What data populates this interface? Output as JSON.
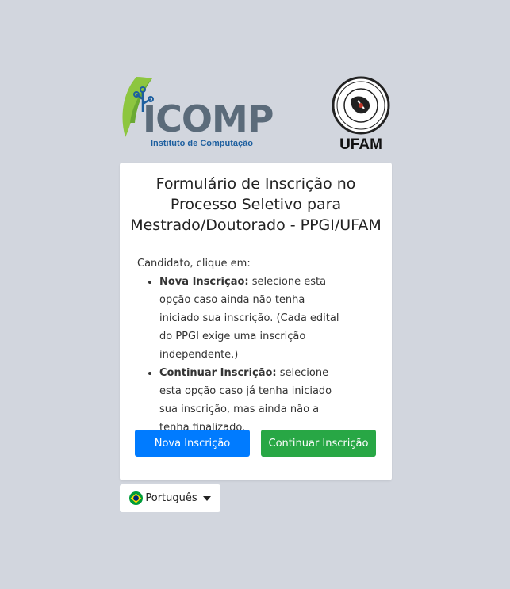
{
  "header": {
    "icomp_logo_text": "ICOMP",
    "icomp_subtitle": "Instituto de Computação",
    "ufam_label": "UFAM"
  },
  "card": {
    "title_line1": "Formulário de Inscrição no",
    "title_line2": "Processo Seletivo para",
    "title_line3": "Mestrado/Doutorado - PPGI/UFAM",
    "intro": "Candidato, clique em:",
    "items": [
      {
        "label": "Nova Inscrição:",
        "text": " selecione esta opção caso ainda não tenha iniciado sua inscrição. (Cada edital do PPGI exige uma inscrição independente.)"
      },
      {
        "label": "Continuar Inscrição:",
        "text": " selecione esta opção caso já tenha iniciado sua inscrição, mas ainda não a tenha finalizado."
      }
    ],
    "new_button_label": "Nova Inscrição",
    "continue_button_label": "Continuar Inscrição"
  },
  "language": {
    "selected": "Português",
    "flag_icon": "brazil-flag-icon"
  },
  "colors": {
    "background": "#d2d6de",
    "primary": "#007bff",
    "success": "#28a745"
  }
}
